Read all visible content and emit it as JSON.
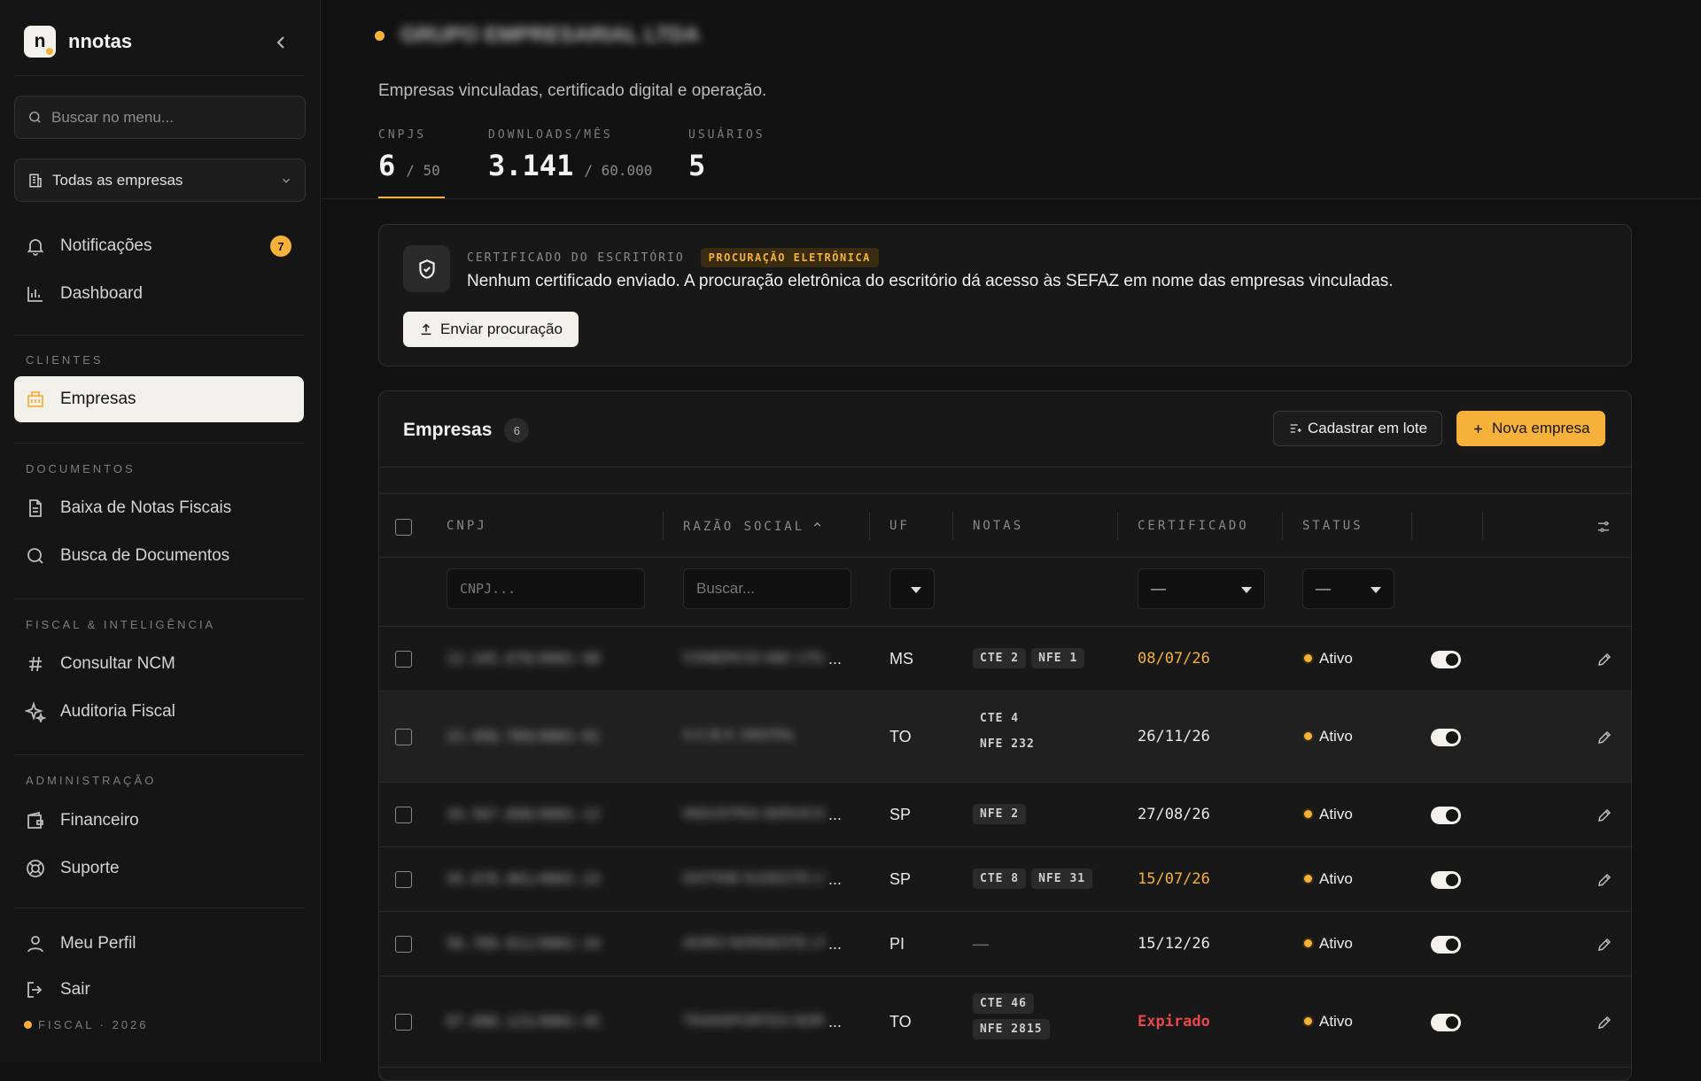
{
  "app": {
    "name": "nnotas",
    "logo_letter": "n",
    "footer": "FISCAL · 2026"
  },
  "colors": {
    "accent": "#f5b13a",
    "background": "#121212",
    "danger": "#e5484d"
  },
  "sidebar": {
    "search_placeholder": "Buscar no menu...",
    "company_selector": "Todas as empresas",
    "top_items": [
      {
        "label": "Notificações",
        "icon": "bell-icon",
        "badge": "7"
      },
      {
        "label": "Dashboard",
        "icon": "bar-chart-icon"
      }
    ],
    "sections": [
      {
        "title": "CLIENTES",
        "items": [
          {
            "label": "Empresas",
            "icon": "building-icon",
            "active": true
          }
        ]
      },
      {
        "title": "DOCUMENTOS",
        "items": [
          {
            "label": "Baixa de Notas Fiscais",
            "icon": "file-text-icon"
          },
          {
            "label": "Busca de Documentos",
            "icon": "search-icon"
          }
        ]
      },
      {
        "title": "FISCAL & INTELIGÊNCIA",
        "items": [
          {
            "label": "Consultar NCM",
            "icon": "hash-icon"
          },
          {
            "label": "Auditoria Fiscal",
            "icon": "sparkles-icon"
          }
        ]
      },
      {
        "title": "ADMINISTRAÇÃO",
        "items": [
          {
            "label": "Financeiro",
            "icon": "wallet-icon"
          },
          {
            "label": "Suporte",
            "icon": "lifebuoy-icon"
          }
        ]
      }
    ],
    "bottom_items": [
      {
        "label": "Meu Perfil",
        "icon": "user-icon"
      },
      {
        "label": "Sair",
        "icon": "logout-icon"
      }
    ]
  },
  "header": {
    "title": "GRUPO EMPRESARIAL LTDA",
    "subtitle": "Empresas vinculadas, certificado digital e operação.",
    "stats": [
      {
        "label": "CNPJS",
        "value": "6",
        "limit": "/ 50"
      },
      {
        "label": "DOWNLOADS/MÊS",
        "value": "3.141",
        "limit": "/ 60.000"
      },
      {
        "label": "USUÁRIOS",
        "value": "5",
        "limit": ""
      }
    ]
  },
  "certificate": {
    "label": "CERTIFICADO DO ESCRITÓRIO",
    "tag": "PROCURAÇÃO ELETRÔNICA",
    "message": "Nenhum certificado enviado. A procuração eletrônica do escritório dá acesso às SEFAZ em nome das empresas vinculadas.",
    "button": "Enviar procuração"
  },
  "companies": {
    "title": "Empresas",
    "count": "6",
    "batch_button": "Cadastrar em lote",
    "new_button": "Nova empresa",
    "columns": {
      "cnpj": "CNPJ",
      "razao": "RAZÃO SOCIAL",
      "uf": "UF",
      "notas": "NOTAS",
      "certificado": "CERTIFICADO",
      "status": "STATUS"
    },
    "filters": {
      "cnpj_placeholder": "CNPJ...",
      "razao_placeholder": "Buscar...",
      "cert_value": "—",
      "status_value": "—"
    },
    "rows": [
      {
        "cnpj": "12.345.678/0001-90",
        "razao": "COMERCIO ABC LTDA",
        "uf": "MS",
        "notas": [
          "CTE 2",
          "NFE 1"
        ],
        "cert": "08/07/26",
        "cert_state": "warn",
        "status": "Ativo"
      },
      {
        "cnpj": "23.456.789/0001-01",
        "razao": "A.C.B.X. DIGITAL",
        "uf": "TO",
        "notas": [
          "CTE 4",
          "NFE 232"
        ],
        "cert": "26/11/26",
        "cert_state": "ok",
        "status": "Ativo"
      },
      {
        "cnpj": "34.567.890/0001-12",
        "razao": "INDUSTRIA SERVICOS LTDA",
        "uf": "SP",
        "notas": [
          "NFE 2"
        ],
        "cert": "27/08/26",
        "cert_state": "ok",
        "status": "Ativo"
      },
      {
        "cnpj": "45.678.901/0001-23",
        "razao": "DISTRIB SUDESTE LTDA",
        "uf": "SP",
        "notas": [
          "CTE 8",
          "NFE 31"
        ],
        "cert": "15/07/26",
        "cert_state": "warn",
        "status": "Ativo"
      },
      {
        "cnpj": "56.789.012/0001-34",
        "razao": "AGRO NORDESTE LTDA",
        "uf": "PI",
        "notas": [],
        "cert": "15/12/26",
        "cert_state": "ok",
        "status": "Ativo"
      },
      {
        "cnpj": "67.890.123/0001-45",
        "razao": "TRANSPORTES NORTE LTDA",
        "uf": "TO",
        "notas": [
          "CTE 46",
          "NFE 2815"
        ],
        "cert": "Expirado",
        "cert_state": "expired",
        "status": "Ativo"
      }
    ]
  }
}
